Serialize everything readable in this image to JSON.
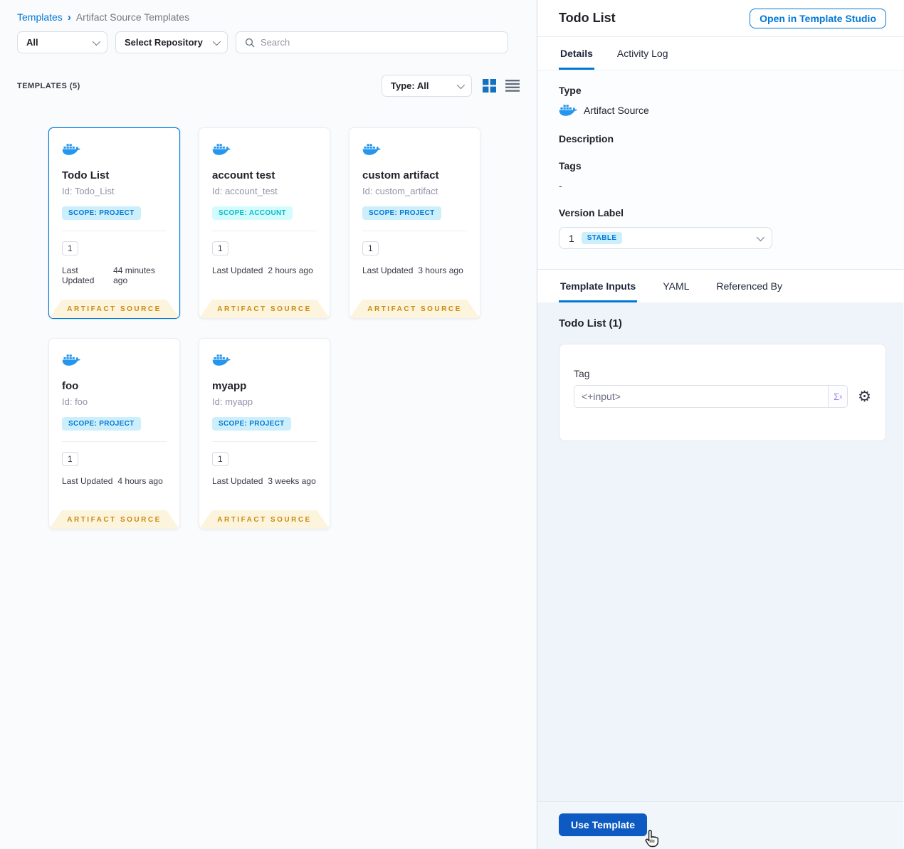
{
  "breadcrumb": {
    "root": "Templates",
    "current": "Artifact Source Templates"
  },
  "filters": {
    "scope_filter": "All",
    "repository_filter": "Select Repository",
    "search_placeholder": "Search"
  },
  "list_header": {
    "count_label": "TEMPLATES (5)",
    "type_filter": "Type: All"
  },
  "cards": [
    {
      "title": "Todo List",
      "id": "Id: Todo_List",
      "scope": "SCOPE: PROJECT",
      "versions": "1",
      "updated_label": "Last Updated",
      "updated": "44 minutes ago",
      "footer": "ARTIFACT SOURCE"
    },
    {
      "title": "account test",
      "id": "Id: account_test",
      "scope": "SCOPE: ACCOUNT",
      "versions": "1",
      "updated_label": "Last Updated",
      "updated": "2 hours ago",
      "footer": "ARTIFACT SOURCE"
    },
    {
      "title": "custom artifact",
      "id": "Id: custom_artifact",
      "scope": "SCOPE: PROJECT",
      "versions": "1",
      "updated_label": "Last Updated",
      "updated": "3 hours ago",
      "footer": "ARTIFACT SOURCE"
    },
    {
      "title": "foo",
      "id": "Id: foo",
      "scope": "SCOPE: PROJECT",
      "versions": "1",
      "updated_label": "Last Updated",
      "updated": "4 hours ago",
      "footer": "ARTIFACT SOURCE"
    },
    {
      "title": "myapp",
      "id": "Id: myapp",
      "scope": "SCOPE: PROJECT",
      "versions": "1",
      "updated_label": "Last Updated",
      "updated": "3 weeks ago",
      "footer": "ARTIFACT SOURCE"
    }
  ],
  "panel": {
    "title": "Todo List",
    "open_button": "Open in Template Studio",
    "tabs": {
      "details": "Details",
      "activity_log": "Activity Log"
    },
    "details": {
      "type_label": "Type",
      "type_value": "Artifact Source",
      "description_label": "Description",
      "tags_label": "Tags",
      "tags_value": "-",
      "version_label": "Version Label",
      "version_value": "1",
      "version_badge": "STABLE"
    },
    "sub_tabs": {
      "inputs": "Template Inputs",
      "yaml": "YAML",
      "referenced": "Referenced By"
    },
    "inputs_title": "Todo List (1)",
    "tag_label": "Tag",
    "tag_value": "<+input>",
    "use_template": "Use Template"
  },
  "colors": {
    "accent_blue": "#0278d5",
    "docker_blue": "#2496ed",
    "button_blue": "#0d5ac2",
    "scope_project_bg": "#cdeffc",
    "scope_account_bg": "#d3fcfe",
    "scope_account_text": "#0ab9c9",
    "ribbon_bg": "#fcf4dd",
    "ribbon_text": "#ca8a0e"
  }
}
